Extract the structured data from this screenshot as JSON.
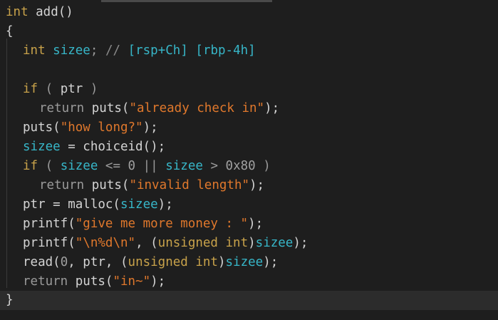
{
  "code": {
    "l1": {
      "kw": "int",
      "name": " add()"
    },
    "l2": {
      "text": "{"
    },
    "l3": {
      "type": "int",
      "var": "sizee",
      "semi": ";",
      "cmt": "//",
      "reg1": "[rsp+Ch]",
      "reg2": "[rbp-4h]"
    },
    "l5": {
      "kw": "if",
      "open": " ( ",
      "var": "ptr",
      "close": " )"
    },
    "l6": {
      "kw": "return",
      "fn": " puts(",
      "str": "\"already check in\"",
      "end": ");"
    },
    "l7": {
      "fn": "puts(",
      "str": "\"how long?\"",
      "end": ");"
    },
    "l8": {
      "var": "sizee",
      "mid": " = choiceid();"
    },
    "l9": {
      "kw": "if",
      "open": " ( ",
      "var1": "sizee",
      "op1": " <= ",
      "num1": "0",
      "op2": " || ",
      "var2": "sizee",
      "op3": " > ",
      "num2": "0x80",
      "close": " )"
    },
    "l10": {
      "kw": "return",
      "fn": " puts(",
      "str": "\"invalid length\"",
      "end": ");"
    },
    "l11": {
      "pre": "ptr = malloc(",
      "var": "sizee",
      "end": ");"
    },
    "l12": {
      "fn": "printf(",
      "str": "\"give me more money : \"",
      "end": ");"
    },
    "l13": {
      "fn": "printf(",
      "str": "\"\\n%d\\n\"",
      "mid": ", (",
      "type": "unsigned int",
      "rp": ")",
      "var": "sizee",
      "end": ");"
    },
    "l14": {
      "pre": "read(",
      "num": "0",
      "mid": ", ptr, (",
      "type": "unsigned int",
      "rp": ")",
      "var": "sizee",
      "end": ");"
    },
    "l15": {
      "kw": "return",
      "fn": " puts(",
      "str": "\"in~\"",
      "end": ");"
    },
    "l16": {
      "text": "}"
    }
  },
  "colors": {
    "background": "#1e1e1e",
    "keyword": "#c8a24a",
    "variable": "#37b6c8",
    "string": "#e0782c",
    "text": "#d4d4d4"
  }
}
